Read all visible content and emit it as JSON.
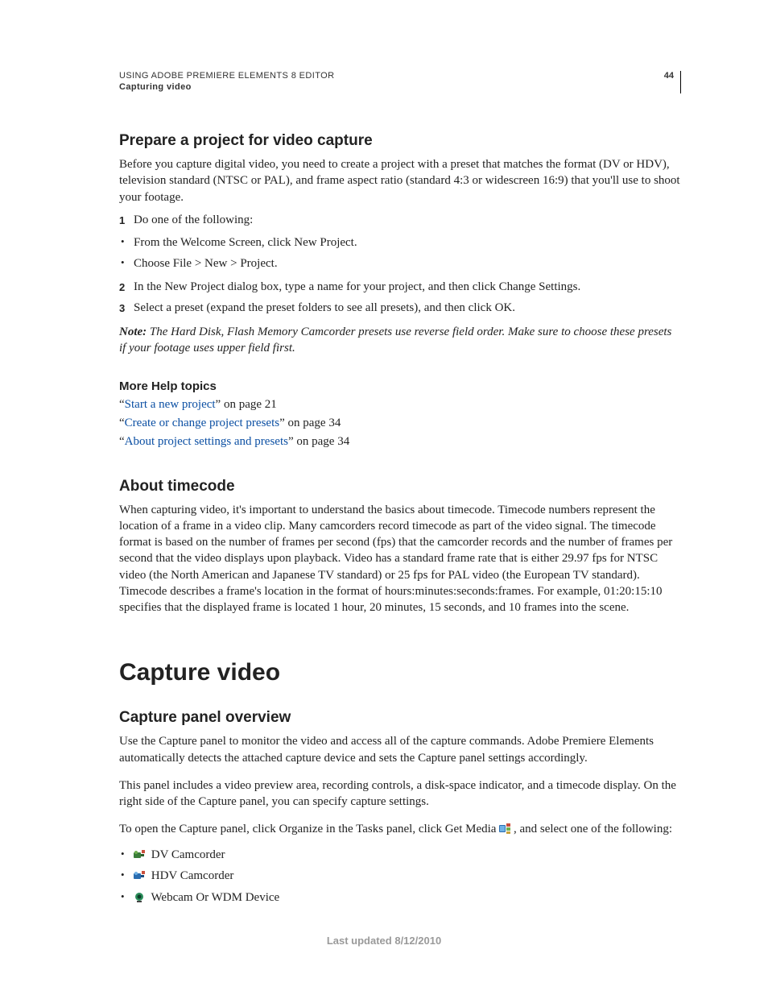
{
  "header": {
    "doc_title": "USING ADOBE PREMIERE ELEMENTS 8 EDITOR",
    "chapter": "Capturing video",
    "page_number": "44"
  },
  "section1": {
    "title": "Prepare a project for video capture",
    "intro": "Before you capture digital video, you need to create a project with a preset that matches the format (DV or HDV), television standard (NTSC or PAL), and frame aspect ratio (standard 4:3 or widescreen 16:9) that you'll use to shoot your footage.",
    "steps": {
      "s1": "Do one of the following:",
      "s1a": "From the Welcome Screen, click New Project.",
      "s1b": "Choose File > New > Project.",
      "s2": "In the New Project dialog box, type a name for your project, and then click Change Settings.",
      "s3": "Select a preset (expand the preset folders to see all presets), and then click OK."
    },
    "note_label": "Note:",
    "note_text": " The Hard Disk, Flash Memory Camcorder presets use reverse field order. Make sure to choose these presets if your footage uses upper field first.",
    "more_help_heading": "More Help topics",
    "help": {
      "h1_pre": "“",
      "h1_link": "Start a new project",
      "h1_post": "” on page 21",
      "h2_pre": "“",
      "h2_link": "Create or change project presets",
      "h2_post": "” on page 34",
      "h3_pre": "“",
      "h3_link": "About project settings and presets",
      "h3_post": "” on page 34"
    }
  },
  "section2": {
    "title": "About timecode",
    "body": "When capturing video, it's important to understand the basics about timecode. Timecode numbers represent the location of a frame in a video clip. Many camcorders record timecode as part of the video signal. The timecode format is based on the number of frames per second (fps) that the camcorder records and the number of frames per second that the video displays upon playback. Video has a standard frame rate that is either 29.97 fps for NTSC video (the North American and Japanese TV standard) or 25 fps for PAL video (the European TV standard). Timecode describes a frame's location in the format of hours:minutes:seconds:frames. For example, 01:20:15:10 specifies that the displayed frame is located 1 hour, 20 minutes, 15 seconds, and 10 frames into the scene."
  },
  "chapter2": {
    "title": "Capture video"
  },
  "section3": {
    "title": "Capture panel overview",
    "p1": "Use the Capture panel to monitor the video and access all of the capture commands. Adobe Premiere Elements automatically detects the attached capture device and sets the Capture panel settings accordingly.",
    "p2": "This panel includes a video preview area, recording controls, a disk-space indicator, and a timecode display. On the right side of the Capture panel, you can specify capture settings.",
    "p3_pre": "To open the Capture panel, click Organize in the Tasks panel, click Get Media ",
    "p3_post": ", and select one of the following:",
    "devices": {
      "d1": " DV Camcorder",
      "d2": " HDV Camcorder",
      "d3": " Webcam Or WDM Device"
    }
  },
  "footer": {
    "last_updated": "Last updated 8/12/2010"
  }
}
